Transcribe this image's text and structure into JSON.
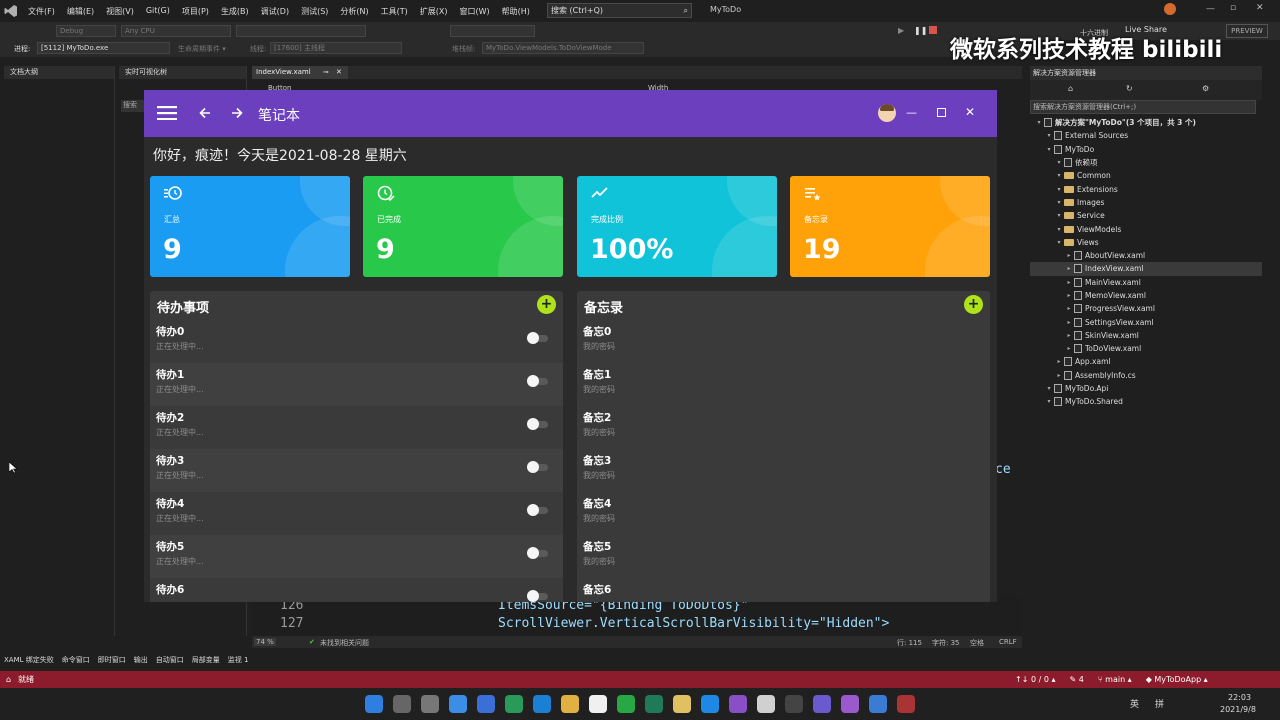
{
  "ide": {
    "menu": [
      "文件(F)",
      "编辑(E)",
      "视图(V)",
      "Git(G)",
      "项目(P)",
      "生成(B)",
      "调试(D)",
      "测试(S)",
      "分析(N)",
      "工具(T)",
      "扩展(X)",
      "窗口(W)",
      "帮助(H)"
    ],
    "search_placeholder": "搜索 (Ctrl+Q)",
    "solution_name": "MyToDo",
    "config": "Debug",
    "platform": "Any CPU",
    "process_label": "进程:",
    "process_value": "[5112] MyToDo.exe",
    "lifecycle": "生命周期事件 ▾",
    "thread_label": "线程:",
    "thread_value": "[17600] 主线程",
    "stack_label": "堆栈帧:",
    "stack_value": "MyToDo.ViewModels.ToDoViewMode",
    "live_share": "Live Share",
    "hex_label": "十六进制",
    "preview": "PREVIEW",
    "left_panel_title": "文档大纲",
    "visual_tree_title": "实时可视化树",
    "visual_tree_search": "搜索",
    "editor_tab": "IndexView.xaml",
    "prop_left": "Button",
    "prop_right": "Width",
    "code_lines": [
      {
        "num": "126",
        "text": "ItemsSource=\"{Binding ToDoDtos}\""
      },
      {
        "num": "127",
        "text": "ScrollViewer.VerticalScrollBarVisibility=\"Hidden\">"
      }
    ],
    "code_fragment": "ce",
    "zoom": "74 %",
    "issues": "未找到相关问题",
    "cursor_line": "行: 115",
    "cursor_char": "字符: 35",
    "spaces": "空格",
    "line_end": "CRLF",
    "bottom_tabs": [
      "XAML 绑定失败",
      "命令窗口",
      "即时窗口",
      "输出",
      "自动窗口",
      "局部变量",
      "监视 1"
    ],
    "status_ready": "就绪",
    "status_right": [
      "↑↓ 0 / 0 ▴",
      "✎ 4",
      "⑂ main ▴",
      "◆ MyToDoApp ▴"
    ],
    "taskbar_time": "22:03",
    "taskbar_date": "2021/9/8",
    "taskbar_lang": "英",
    "taskbar_ime": "拼",
    "watermark": "微软系列技术教程 bilibili"
  },
  "solution_explorer": {
    "title": "解决方案资源管理器",
    "search": "搜索解决方案资源管理器(Ctrl+;)",
    "items": [
      {
        "label": "解决方案\"MyToDo\"(3 个项目，共 3 个)",
        "kind": "sln",
        "bold": true
      },
      {
        "label": "External Sources",
        "kind": "ext"
      },
      {
        "label": "MyToDo",
        "kind": "proj"
      },
      {
        "label": "依赖项",
        "kind": "dep"
      },
      {
        "label": "Common",
        "kind": "folder"
      },
      {
        "label": "Extensions",
        "kind": "folder"
      },
      {
        "label": "Images",
        "kind": "folder"
      },
      {
        "label": "Service",
        "kind": "folder"
      },
      {
        "label": "ViewModels",
        "kind": "folder"
      },
      {
        "label": "Views",
        "kind": "folder"
      },
      {
        "label": "AboutView.xaml",
        "kind": "file"
      },
      {
        "label": "IndexView.xaml",
        "kind": "file",
        "selected": true
      },
      {
        "label": "MainView.xaml",
        "kind": "file"
      },
      {
        "label": "MemoView.xaml",
        "kind": "file"
      },
      {
        "label": "ProgressView.xaml",
        "kind": "file"
      },
      {
        "label": "SettingsView.xaml",
        "kind": "file"
      },
      {
        "label": "SkinView.xaml",
        "kind": "file"
      },
      {
        "label": "ToDoView.xaml",
        "kind": "file"
      },
      {
        "label": "App.xaml",
        "kind": "file"
      },
      {
        "label": "AssemblyInfo.cs",
        "kind": "cs"
      },
      {
        "label": "MyToDo.Api",
        "kind": "proj"
      },
      {
        "label": "MyToDo.Shared",
        "kind": "proj"
      }
    ]
  },
  "app": {
    "title": "笔记本",
    "greeting": "你好，痕迹！今天是2021-08-28 星期六",
    "cards": [
      {
        "label": "汇总",
        "value": "9",
        "color": "#1a9cf3",
        "icon": "clock-list-icon"
      },
      {
        "label": "已完成",
        "value": "9",
        "color": "#28c84a",
        "icon": "clock-check-icon"
      },
      {
        "label": "完成比例",
        "value": "100%",
        "color": "#10c3d8",
        "icon": "trend-icon"
      },
      {
        "label": "备忘录",
        "value": "19",
        "color": "#ffa20a",
        "icon": "list-star-icon"
      }
    ],
    "todo": {
      "title": "待办事项",
      "items": [
        {
          "title": "待办0",
          "sub": "正在处理中..."
        },
        {
          "title": "待办1",
          "sub": "正在处理中..."
        },
        {
          "title": "待办2",
          "sub": "正在处理中..."
        },
        {
          "title": "待办3",
          "sub": "正在处理中..."
        },
        {
          "title": "待办4",
          "sub": "正在处理中..."
        },
        {
          "title": "待办5",
          "sub": "正在处理中..."
        },
        {
          "title": "待办6",
          "sub": ""
        }
      ]
    },
    "memo": {
      "title": "备忘录",
      "items": [
        {
          "title": "备忘0",
          "sub": "我的密码"
        },
        {
          "title": "备忘1",
          "sub": "我的密码"
        },
        {
          "title": "备忘2",
          "sub": "我的密码"
        },
        {
          "title": "备忘3",
          "sub": "我的密码"
        },
        {
          "title": "备忘4",
          "sub": "我的密码"
        },
        {
          "title": "备忘5",
          "sub": "我的密码"
        },
        {
          "title": "备忘6",
          "sub": ""
        }
      ]
    }
  }
}
